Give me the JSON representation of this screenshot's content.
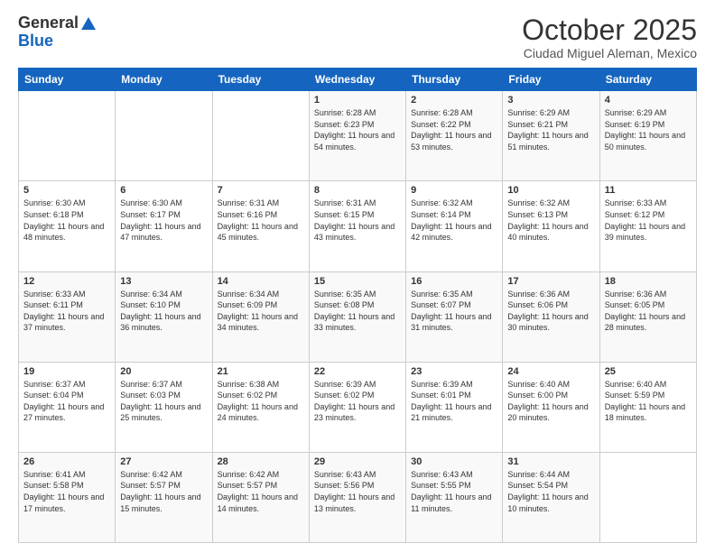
{
  "logo": {
    "line1": "General",
    "line2": "Blue"
  },
  "title": "October 2025",
  "subtitle": "Ciudad Miguel Aleman, Mexico",
  "weekdays": [
    "Sunday",
    "Monday",
    "Tuesday",
    "Wednesday",
    "Thursday",
    "Friday",
    "Saturday"
  ],
  "weeks": [
    [
      {
        "day": "",
        "sunrise": "",
        "sunset": "",
        "daylight": ""
      },
      {
        "day": "",
        "sunrise": "",
        "sunset": "",
        "daylight": ""
      },
      {
        "day": "",
        "sunrise": "",
        "sunset": "",
        "daylight": ""
      },
      {
        "day": "1",
        "sunrise": "6:28 AM",
        "sunset": "6:23 PM",
        "daylight": "11 hours and 54 minutes."
      },
      {
        "day": "2",
        "sunrise": "6:28 AM",
        "sunset": "6:22 PM",
        "daylight": "11 hours and 53 minutes."
      },
      {
        "day": "3",
        "sunrise": "6:29 AM",
        "sunset": "6:21 PM",
        "daylight": "11 hours and 51 minutes."
      },
      {
        "day": "4",
        "sunrise": "6:29 AM",
        "sunset": "6:19 PM",
        "daylight": "11 hours and 50 minutes."
      }
    ],
    [
      {
        "day": "5",
        "sunrise": "6:30 AM",
        "sunset": "6:18 PM",
        "daylight": "11 hours and 48 minutes."
      },
      {
        "day": "6",
        "sunrise": "6:30 AM",
        "sunset": "6:17 PM",
        "daylight": "11 hours and 47 minutes."
      },
      {
        "day": "7",
        "sunrise": "6:31 AM",
        "sunset": "6:16 PM",
        "daylight": "11 hours and 45 minutes."
      },
      {
        "day": "8",
        "sunrise": "6:31 AM",
        "sunset": "6:15 PM",
        "daylight": "11 hours and 43 minutes."
      },
      {
        "day": "9",
        "sunrise": "6:32 AM",
        "sunset": "6:14 PM",
        "daylight": "11 hours and 42 minutes."
      },
      {
        "day": "10",
        "sunrise": "6:32 AM",
        "sunset": "6:13 PM",
        "daylight": "11 hours and 40 minutes."
      },
      {
        "day": "11",
        "sunrise": "6:33 AM",
        "sunset": "6:12 PM",
        "daylight": "11 hours and 39 minutes."
      }
    ],
    [
      {
        "day": "12",
        "sunrise": "6:33 AM",
        "sunset": "6:11 PM",
        "daylight": "11 hours and 37 minutes."
      },
      {
        "day": "13",
        "sunrise": "6:34 AM",
        "sunset": "6:10 PM",
        "daylight": "11 hours and 36 minutes."
      },
      {
        "day": "14",
        "sunrise": "6:34 AM",
        "sunset": "6:09 PM",
        "daylight": "11 hours and 34 minutes."
      },
      {
        "day": "15",
        "sunrise": "6:35 AM",
        "sunset": "6:08 PM",
        "daylight": "11 hours and 33 minutes."
      },
      {
        "day": "16",
        "sunrise": "6:35 AM",
        "sunset": "6:07 PM",
        "daylight": "11 hours and 31 minutes."
      },
      {
        "day": "17",
        "sunrise": "6:36 AM",
        "sunset": "6:06 PM",
        "daylight": "11 hours and 30 minutes."
      },
      {
        "day": "18",
        "sunrise": "6:36 AM",
        "sunset": "6:05 PM",
        "daylight": "11 hours and 28 minutes."
      }
    ],
    [
      {
        "day": "19",
        "sunrise": "6:37 AM",
        "sunset": "6:04 PM",
        "daylight": "11 hours and 27 minutes."
      },
      {
        "day": "20",
        "sunrise": "6:37 AM",
        "sunset": "6:03 PM",
        "daylight": "11 hours and 25 minutes."
      },
      {
        "day": "21",
        "sunrise": "6:38 AM",
        "sunset": "6:02 PM",
        "daylight": "11 hours and 24 minutes."
      },
      {
        "day": "22",
        "sunrise": "6:39 AM",
        "sunset": "6:02 PM",
        "daylight": "11 hours and 23 minutes."
      },
      {
        "day": "23",
        "sunrise": "6:39 AM",
        "sunset": "6:01 PM",
        "daylight": "11 hours and 21 minutes."
      },
      {
        "day": "24",
        "sunrise": "6:40 AM",
        "sunset": "6:00 PM",
        "daylight": "11 hours and 20 minutes."
      },
      {
        "day": "25",
        "sunrise": "6:40 AM",
        "sunset": "5:59 PM",
        "daylight": "11 hours and 18 minutes."
      }
    ],
    [
      {
        "day": "26",
        "sunrise": "6:41 AM",
        "sunset": "5:58 PM",
        "daylight": "11 hours and 17 minutes."
      },
      {
        "day": "27",
        "sunrise": "6:42 AM",
        "sunset": "5:57 PM",
        "daylight": "11 hours and 15 minutes."
      },
      {
        "day": "28",
        "sunrise": "6:42 AM",
        "sunset": "5:57 PM",
        "daylight": "11 hours and 14 minutes."
      },
      {
        "day": "29",
        "sunrise": "6:43 AM",
        "sunset": "5:56 PM",
        "daylight": "11 hours and 13 minutes."
      },
      {
        "day": "30",
        "sunrise": "6:43 AM",
        "sunset": "5:55 PM",
        "daylight": "11 hours and 11 minutes."
      },
      {
        "day": "31",
        "sunrise": "6:44 AM",
        "sunset": "5:54 PM",
        "daylight": "11 hours and 10 minutes."
      },
      {
        "day": "",
        "sunrise": "",
        "sunset": "",
        "daylight": ""
      }
    ]
  ]
}
